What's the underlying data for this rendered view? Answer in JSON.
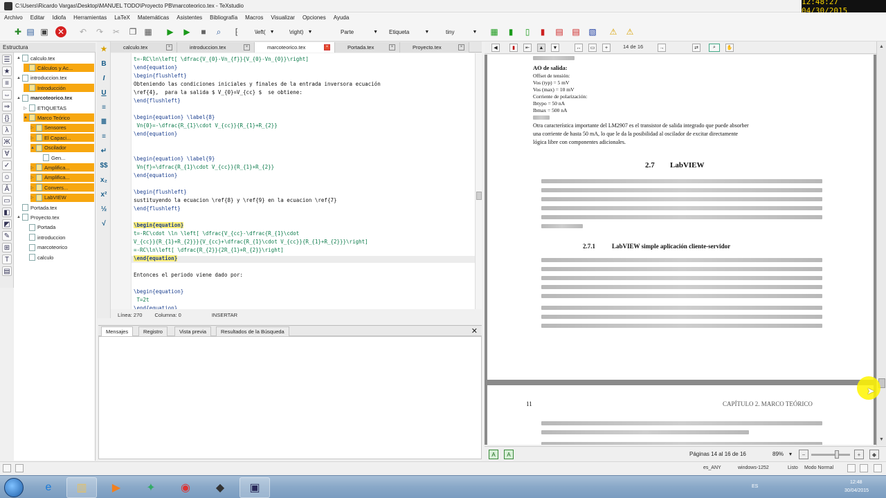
{
  "window": {
    "title": "C:\\Users\\Ricardo Vargas\\Desktop\\MANUEL TODO\\Proyecto PB\\marcoteorico.tex - TeXstudio",
    "clock": "12:48:27 04/30/2015"
  },
  "menu": [
    "Archivo",
    "Editar",
    "Idiofa",
    "Herramientas",
    "LaTeX",
    "Matemáticas",
    "Asistentes",
    "Bibliografía",
    "Macros",
    "Visualizar",
    "Opciones",
    "Ayuda"
  ],
  "toolbar": {
    "left_delim": "\\left(",
    "right_delim": "\\right)",
    "part": "Parte",
    "label": "Etiqueta",
    "size": "tiny"
  },
  "structure": {
    "header": "Estructura",
    "items": [
      {
        "label": "calculo.tex",
        "level": 0,
        "toggle": "▲",
        "highlight": false,
        "bold": false
      },
      {
        "label": "Cálculos y Ac...",
        "level": 1,
        "toggle": "",
        "highlight": true,
        "bold": false
      },
      {
        "label": "introduccion.tex",
        "level": 0,
        "toggle": "▲",
        "highlight": false,
        "bold": false
      },
      {
        "label": "Introducción",
        "level": 1,
        "toggle": "",
        "highlight": true,
        "bold": false
      },
      {
        "label": "marcoteorico.tex",
        "level": 0,
        "toggle": "▲",
        "highlight": false,
        "bold": true
      },
      {
        "label": "ETIQUETAS",
        "level": 1,
        "toggle": "▷",
        "highlight": false,
        "bold": false
      },
      {
        "label": "Marco Teórico",
        "level": 1,
        "toggle": "▲",
        "highlight": true,
        "bold": false
      },
      {
        "label": "Sensores",
        "level": 2,
        "toggle": "▷",
        "highlight": true,
        "bold": false
      },
      {
        "label": "El Capaci...",
        "level": 2,
        "toggle": "▷",
        "highlight": true,
        "bold": false
      },
      {
        "label": "Oscilador",
        "level": 2,
        "toggle": "▲",
        "highlight": true,
        "bold": false
      },
      {
        "label": "Gen...",
        "level": 3,
        "toggle": "",
        "highlight": false,
        "bold": false
      },
      {
        "label": "Amplifica...",
        "level": 2,
        "toggle": "▷",
        "highlight": true,
        "bold": false
      },
      {
        "label": "Amplifica...",
        "level": 2,
        "toggle": "▷",
        "highlight": true,
        "bold": false
      },
      {
        "label": "Convers...",
        "level": 2,
        "toggle": "▷",
        "highlight": true,
        "bold": false
      },
      {
        "label": "LabVIEW",
        "level": 2,
        "toggle": "▷",
        "highlight": true,
        "bold": false
      },
      {
        "label": "Portada.tex",
        "level": 0,
        "toggle": "",
        "highlight": false,
        "bold": false
      },
      {
        "label": "Proyecto.tex",
        "level": 0,
        "toggle": "▲",
        "highlight": false,
        "bold": false
      },
      {
        "label": "Portada",
        "level": 1,
        "toggle": "",
        "highlight": false,
        "bold": false
      },
      {
        "label": "introduccion",
        "level": 1,
        "toggle": "",
        "highlight": false,
        "bold": false
      },
      {
        "label": "marcoteorico",
        "level": 1,
        "toggle": "",
        "highlight": false,
        "bold": false
      },
      {
        "label": "calculo",
        "level": 1,
        "toggle": "",
        "highlight": false,
        "bold": false
      }
    ]
  },
  "tabs": [
    {
      "label": "calculo.tex",
      "active": false
    },
    {
      "label": "introduccion.tex",
      "active": false
    },
    {
      "label": "marcoteorico.tex",
      "active": true
    },
    {
      "label": "Portada.tex",
      "active": false
    },
    {
      "label": "Proyecto.tex",
      "active": false
    }
  ],
  "editor": {
    "lines": [
      {
        "text": "t=-RC\\ln\\left[ \\dfrac{V_{0}-Vn_{f}}{V_{0}-Vn_{0}}\\right]",
        "kind": "math"
      },
      {
        "text": "\\end{equation}",
        "kind": "cmd"
      },
      {
        "text": "\\begin{flushleft}",
        "kind": "cmd"
      },
      {
        "text": "Obteniendo las condiciones iniciales y finales de la entrada inversora ecuación",
        "kind": "text"
      },
      {
        "text": "\\ref{4},  para la salida $ V_{0}=V_{cc} $  se obtiene:",
        "kind": "text"
      },
      {
        "text": "\\end{flushleft}",
        "kind": "cmd"
      },
      {
        "text": "",
        "kind": "text"
      },
      {
        "text": "\\begin{equation} \\label{8}",
        "kind": "cmd"
      },
      {
        "text": " Vn{0}=-\\dfrac{R_{1}\\cdot V_{cc}}{R_{1}+R_{2}}",
        "kind": "math"
      },
      {
        "text": "\\end{equation}",
        "kind": "cmd"
      },
      {
        "text": "",
        "kind": "text"
      },
      {
        "text": "",
        "kind": "text"
      },
      {
        "text": "\\begin{equation} \\label{9}",
        "kind": "cmd"
      },
      {
        "text": " Vn{f}=\\dfrac{R_{1}\\cdot V_{cc}}{R_{1}+R_{2}}",
        "kind": "math"
      },
      {
        "text": "\\end{equation}",
        "kind": "cmd"
      },
      {
        "text": "",
        "kind": "text"
      },
      {
        "text": "\\begin{flushleft}",
        "kind": "cmd"
      },
      {
        "text": "sustituyendo la ecuacion \\ref{8} y \\ref{9} en la ecuacion \\ref{7}",
        "kind": "text"
      },
      {
        "text": "\\end{flushleft}",
        "kind": "cmd"
      },
      {
        "text": "",
        "kind": "text"
      },
      {
        "text": "\\begin{equation}",
        "kind": "hl"
      },
      {
        "text": "t=-RC\\cdot \\ln \\left[ \\dfrac{V_{cc}-\\dfrac{R_{1}\\cdot",
        "kind": "math"
      },
      {
        "text": "V_{cc}}{R_{1}+R_{2}}}{V_{cc}+\\dfrac{R_{1}\\cdot V_{cc}}{R_{1}+R_{2}}}\\right]",
        "kind": "math"
      },
      {
        "text": "=-RC\\ln\\left[ \\dfrac{R_{2}}{2R_{1}+R_{2}}\\right]",
        "kind": "math"
      },
      {
        "text": "\\end{equation}",
        "kind": "hl"
      },
      {
        "text": "",
        "kind": "text"
      },
      {
        "text": "Entonces el periodo viene dado por:",
        "kind": "text"
      },
      {
        "text": "",
        "kind": "text"
      },
      {
        "text": "\\begin{equation}",
        "kind": "cmd"
      },
      {
        "text": " T=2t",
        "kind": "math"
      },
      {
        "text": "\\end{equation}",
        "kind": "cmd"
      }
    ],
    "status": {
      "line": "Línea: 270",
      "column": "Columna: 0",
      "mode": "INSERTAR"
    }
  },
  "messages": {
    "tabs": [
      "Mensajes",
      "Registro",
      "Vista previa",
      "Resultados de la Búsqueda"
    ],
    "close": "✕"
  },
  "pdf": {
    "page_indicator": "14 de 16",
    "page1": {
      "heading_small": "AO de salida:",
      "spec_lines": [
        "Offset de tensión:",
        "Vos (typ) = 5 mV",
        "Vos (max) = 10 mV",
        "Corriente de polarización:",
        "Ibtypo = 50 nA",
        "Ibmax = 500 nA"
      ],
      "para": [
        "Otra característica importante del LM2907 es el transistor de salida integrado que puede absorber",
        "una corriente de hasta 50 mA, lo que le da la posibilidad al oscilador de excitar directamente",
        "lógica libre con componentes adicionales."
      ],
      "section_num": "2.7",
      "section_title": "LabVIEW",
      "subsection_num": "2.7.1",
      "subsection_title": "LabVIEW simple aplicación cliente-servidor"
    },
    "page2": {
      "page_num": "11",
      "chapter": "CAPÍTULO 2.  MARCO TEÓRICO"
    },
    "status": {
      "pages": "Páginas 14 al 16 de 16",
      "zoom": "89%"
    }
  },
  "statusbar": {
    "lang": "es_ANY",
    "encoding": "windows-1252",
    "ready": "Listo",
    "mode": "Modo Normal"
  },
  "taskbar": {
    "time": "12:48",
    "date": "30/04/2015",
    "lang": "ES"
  }
}
